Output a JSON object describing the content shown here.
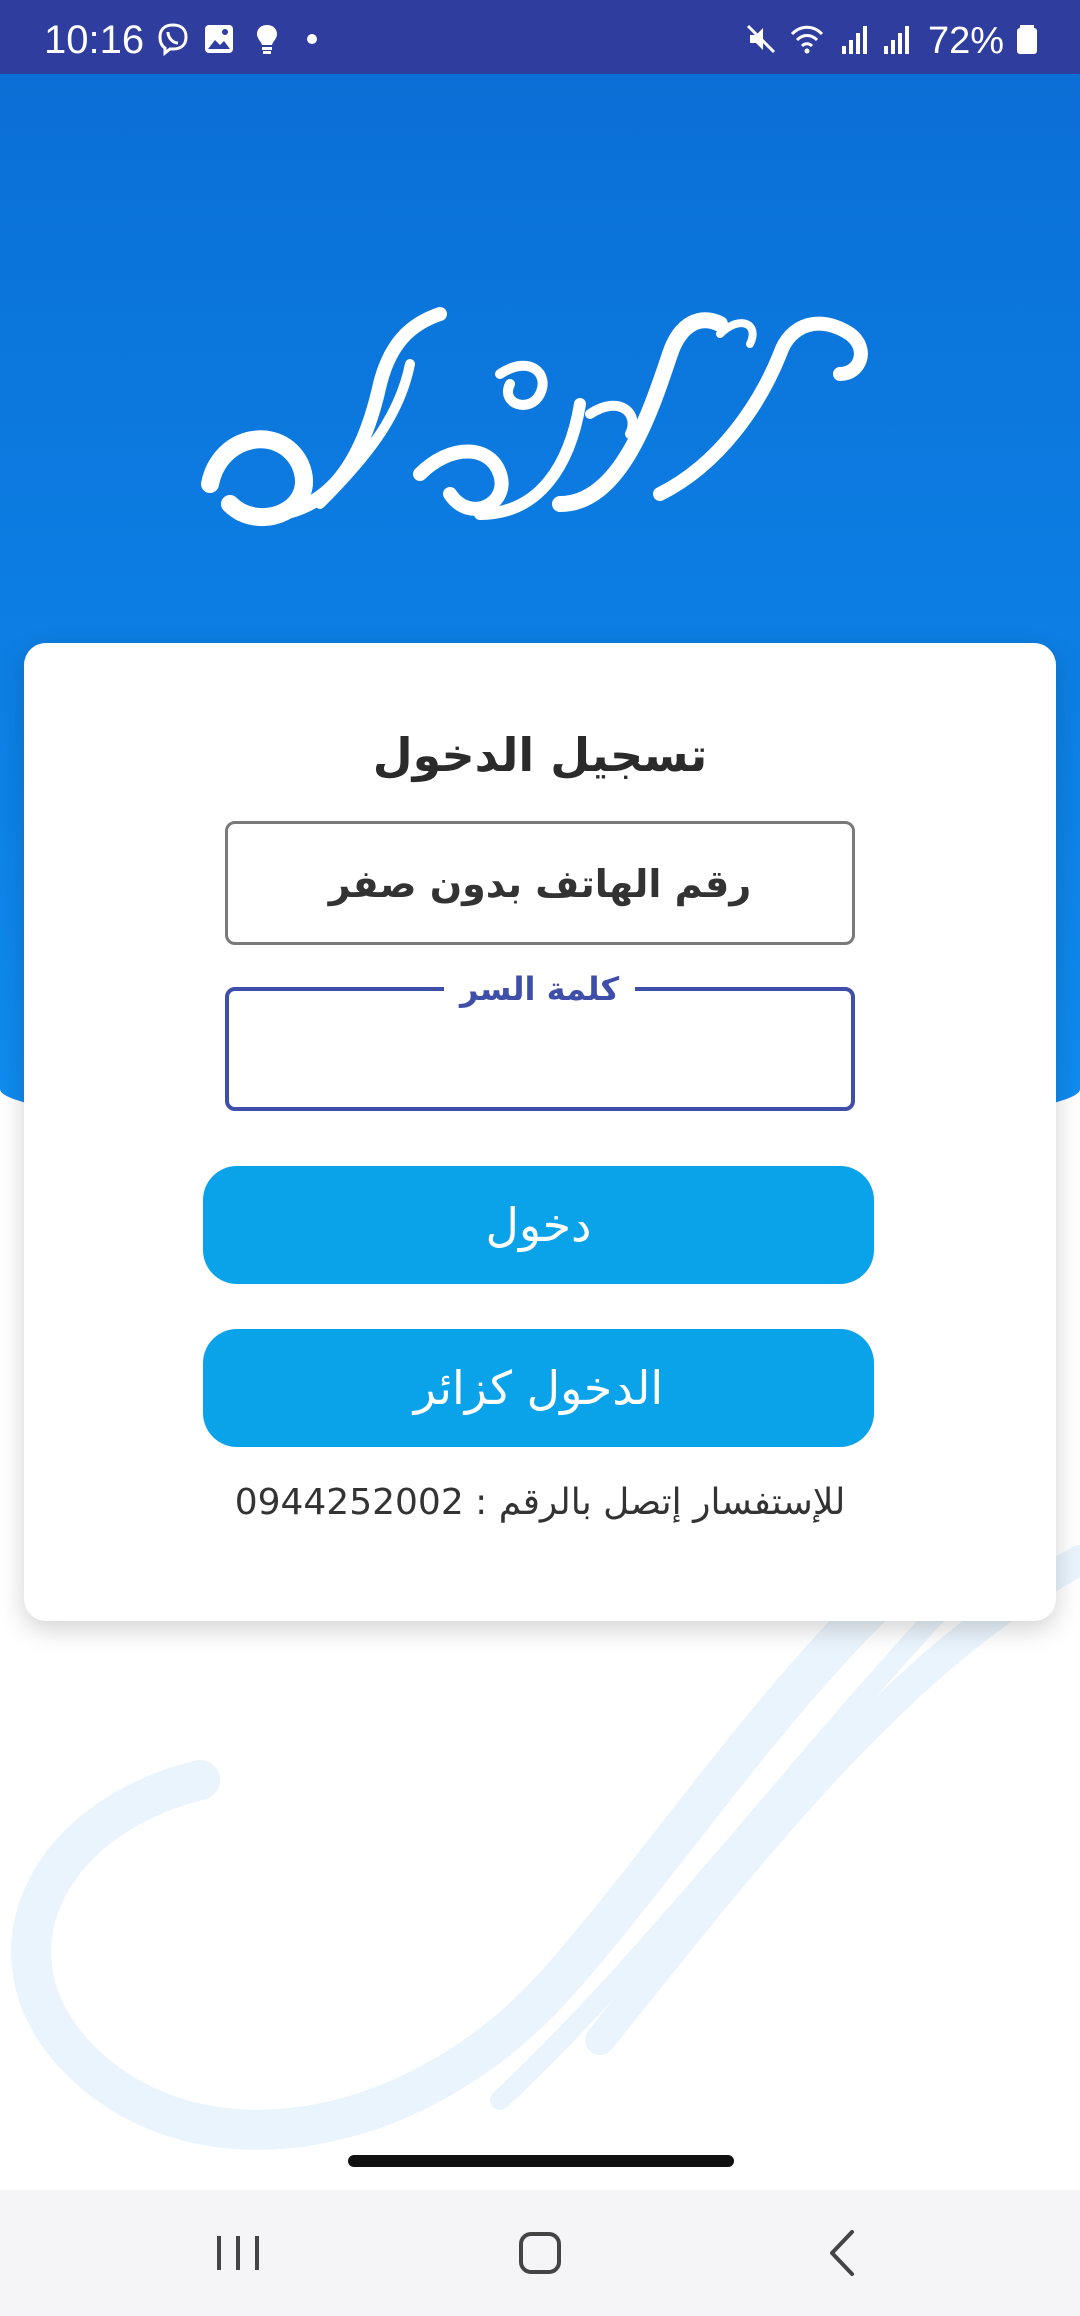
{
  "status_bar": {
    "time": "10:16",
    "battery_percent": "72%",
    "icons": [
      "viber-icon",
      "gallery-icon",
      "lightbulb-icon",
      "dot-icon",
      "mute-icon",
      "wifi-icon",
      "signal-icon",
      "signal-icon",
      "battery-icon"
    ]
  },
  "colors": {
    "hero_blue": "#0a6fd6",
    "button_blue": "#0aa3ea",
    "status_bar": "#2f3e9e",
    "focus_border": "#3f4ea8"
  },
  "login_card": {
    "title": "تسجيل الدخول",
    "phone_field": {
      "placeholder": "رقم الهاتف بدون صفر"
    },
    "password_field": {
      "label": "كلمة السر",
      "value": ""
    },
    "login_button": "دخول",
    "visitor_button": "الدخول كزائر",
    "inquiry_text": "للإستفسار إتصل بالرقم : 0944252002"
  },
  "nav_bar": {
    "buttons": [
      "recent-apps-icon",
      "home-icon",
      "back-icon"
    ]
  }
}
